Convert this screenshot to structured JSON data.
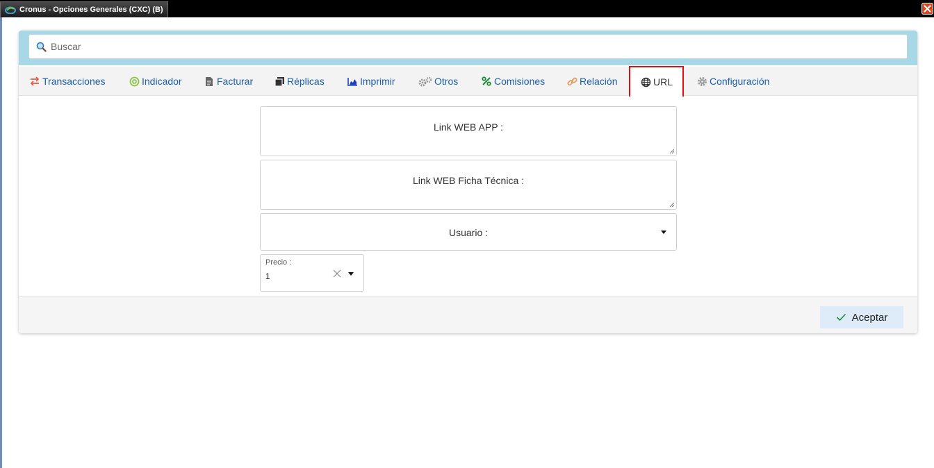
{
  "window": {
    "title": "Cronus - Opciones Generales (CXC) (B)"
  },
  "search": {
    "placeholder": "Buscar"
  },
  "tabs": [
    {
      "label": "Transacciones",
      "icon": "arrows-exchange-icon",
      "color": "#e8584a"
    },
    {
      "label": "Indicador",
      "icon": "target-icon",
      "color": "#8bc34a"
    },
    {
      "label": "Facturar",
      "icon": "document-icon",
      "color": "#555555"
    },
    {
      "label": "Réplicas",
      "icon": "copy-icon",
      "color": "#333333"
    },
    {
      "label": "Imprimir",
      "icon": "area-chart-icon",
      "color": "#1a3fbf"
    },
    {
      "label": "Otros",
      "icon": "gears-icon",
      "color": "#9a9a9a"
    },
    {
      "label": "Comisiones",
      "icon": "percent-icon",
      "color": "#1e8c3a"
    },
    {
      "label": "Relación",
      "icon": "link-icon",
      "color": "#e0a060"
    },
    {
      "label": "URL",
      "icon": "globe-icon",
      "color": "#333333",
      "active": true
    },
    {
      "label": "Configuración",
      "icon": "gear-icon",
      "color": "#9a9a9a"
    }
  ],
  "form": {
    "link_web_app_label": "Link WEB APP :",
    "link_ficha_label": "Link WEB Ficha Técnica :",
    "usuario_label": "Usuario :",
    "precio_label": "Precio :",
    "precio_value": "1"
  },
  "footer": {
    "accept_label": "Aceptar"
  },
  "colors": {
    "search_band": "#a8d8e6",
    "active_tab_border": "#e01010",
    "tab_text": "#1a5ea8",
    "accept_bg": "#deecf9"
  }
}
